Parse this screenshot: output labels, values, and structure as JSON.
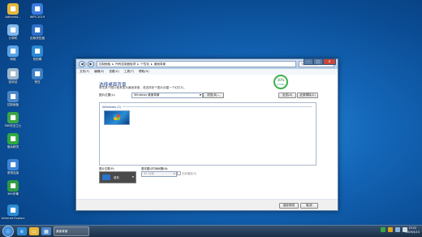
{
  "desktop": {
    "icons": [
      {
        "label": "Administ...",
        "icon": "user-folder-icon",
        "color": "#e4b73a"
      },
      {
        "label": "WPS 2019",
        "icon": "wps-icon",
        "color": "#3a7be0"
      },
      {
        "label": "计算机",
        "icon": "computer-icon",
        "color": "#7fb7ea"
      },
      {
        "label": "旧版快压缩",
        "icon": "doc-icon",
        "color": "#2d6fc8"
      },
      {
        "label": "网络",
        "icon": "network-icon",
        "color": "#5aa2e6"
      },
      {
        "label": "快剪辑",
        "icon": "clip-icon",
        "color": "#2b88d4"
      },
      {
        "label": "回收站",
        "icon": "recycle-bin-icon",
        "color": "#9fb6cc"
      },
      {
        "label": "快压",
        "icon": "zip-icon",
        "color": "#3c7fc4"
      },
      {
        "label": "控制面板",
        "icon": "control-panel-icon",
        "color": "#4b86c7"
      },
      {
        "label": "360安全卫士",
        "icon": "shield-icon",
        "color": "#3aa545"
      },
      {
        "label": "驱动精灵",
        "icon": "driver-icon",
        "color": "#2ea83f"
      },
      {
        "label": "宽带连接",
        "icon": "broadband-icon",
        "color": "#3b84d6"
      },
      {
        "label": "360杀毒",
        "icon": "antivirus-icon",
        "color": "#2f9b43"
      },
      {
        "label": "Internet Explorer",
        "icon": "ie-icon",
        "color": "#2d8bd4"
      }
    ]
  },
  "window": {
    "breadcrumb": [
      "控制面板",
      "所有控制面板项",
      "个性化",
      "桌面背景"
    ],
    "search_placeholder": "搜索控制面板",
    "menu": [
      "文件(F)",
      "编辑(E)",
      "查看(V)",
      "工具(T)",
      "帮助(H)"
    ],
    "heading": "选择桌面背景",
    "subtext": "单击某个图片使其成为桌面背景，或选择多个图片创建一个幻灯片。",
    "location_label": "图片位置(L):",
    "location_value": "Windows 桌面背景",
    "browse_button": "浏览(B)...",
    "select_all_button": "全选(A)",
    "clear_all_button": "全部清除(C)",
    "group_label": "Windows (1)",
    "position_label": "图片位置(P):",
    "position_value": "填充",
    "interval_label": "更改图片时间间隔(N):",
    "interval_value": "30 分钟",
    "shuffle_label": "无序播放(S)",
    "save_button": "保存修改",
    "cancel_button": "取消",
    "badge_value": "30%",
    "badge_sub": "0.1KB/s"
  },
  "taskbar": {
    "task_label": "桌面背景",
    "time": "19:22",
    "date": "2019/4/15"
  }
}
